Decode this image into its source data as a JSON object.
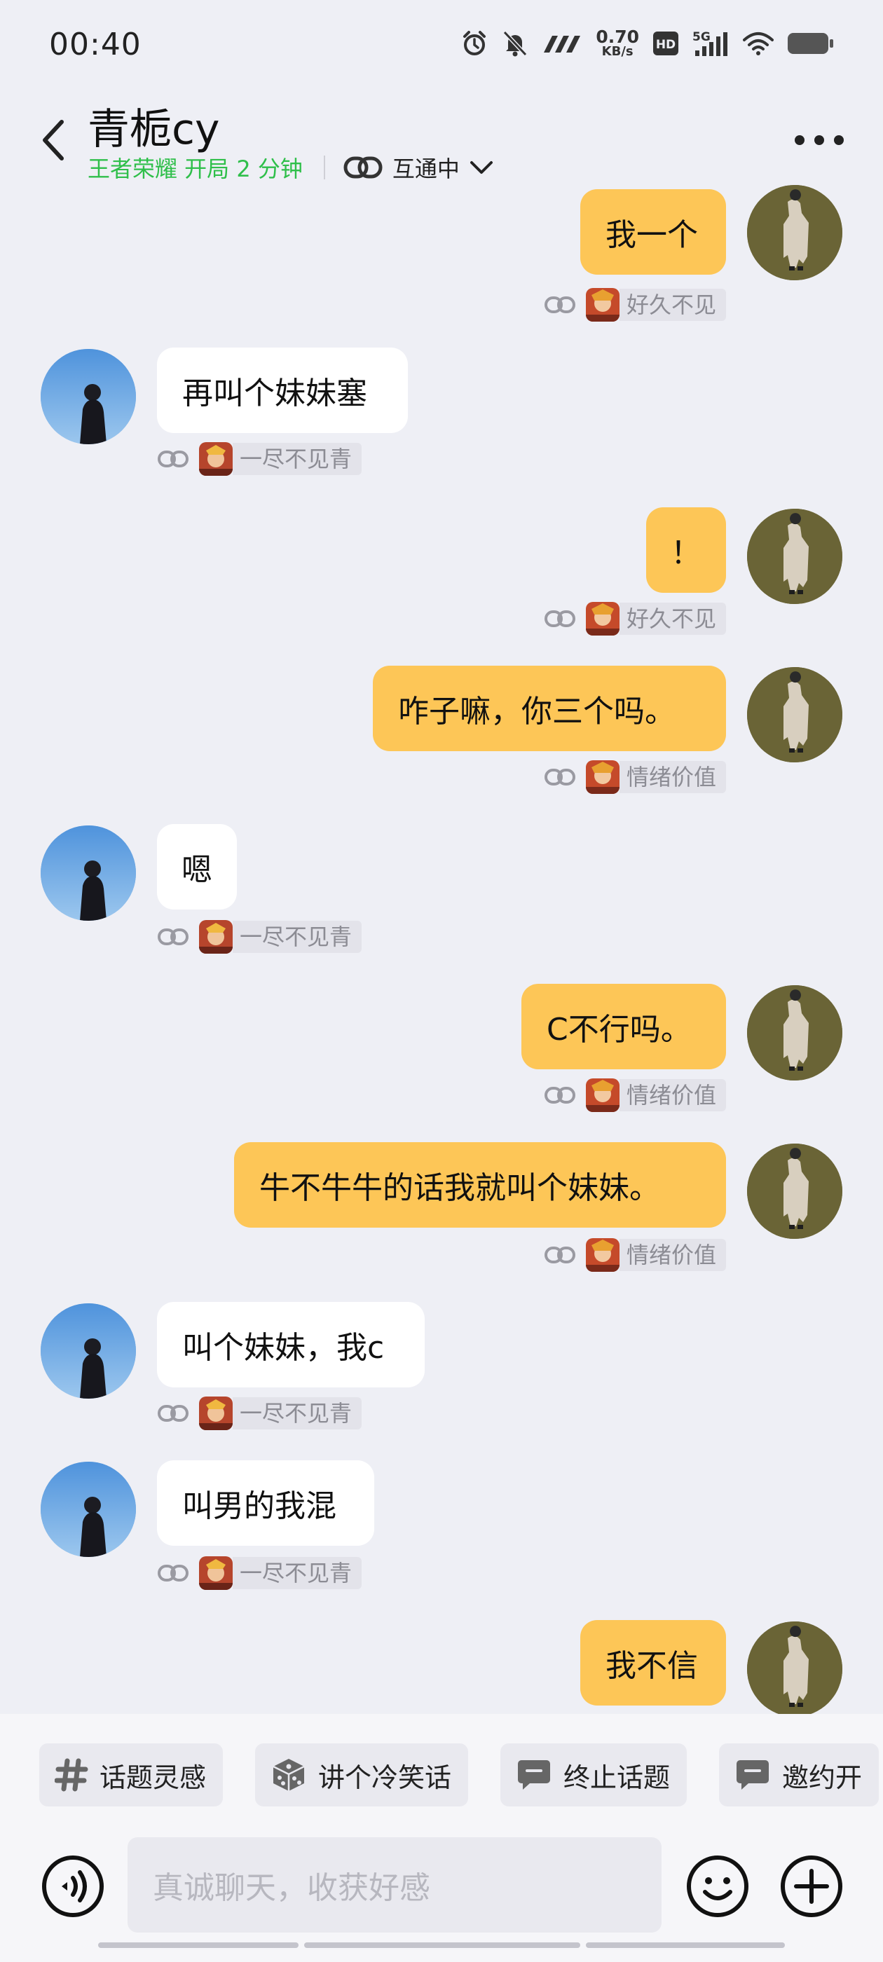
{
  "status_bar": {
    "time": "00:40",
    "net_speed_value": "0.70",
    "net_speed_unit": "KB/s",
    "hd_label": "HD",
    "signal_label": "5G"
  },
  "header": {
    "contact_name": "青栀cy",
    "game_status": "王者荣耀 开局 2 分钟",
    "link_status": "互通中"
  },
  "colors": {
    "self_bubble": "#fdc657",
    "peer_bubble": "#ffffff",
    "game_status_green": "#2fbf4a",
    "background": "#eeeff5"
  },
  "messages": [
    {
      "side": "self",
      "text": "我一个",
      "nickname": "好久不见"
    },
    {
      "side": "peer",
      "text": "再叫个妹妹塞",
      "nickname": "一尽不见青"
    },
    {
      "side": "self",
      "text": "！",
      "nickname": "好久不见"
    },
    {
      "side": "self",
      "text": "咋子嘛，你三个吗。",
      "nickname": "情绪价值"
    },
    {
      "side": "peer",
      "text": "嗯",
      "nickname": "一尽不见青"
    },
    {
      "side": "self",
      "text": "C不行吗。",
      "nickname": "情绪价值"
    },
    {
      "side": "self",
      "text": "牛不牛牛的话我就叫个妹妹。",
      "nickname": "情绪价值"
    },
    {
      "side": "peer",
      "text": "叫个妹妹，我c",
      "nickname": "一尽不见青"
    },
    {
      "side": "peer",
      "text": "叫男的我混",
      "nickname": "一尽不见青"
    },
    {
      "side": "self",
      "text": "我不信",
      "nickname": ""
    }
  ],
  "suggestions": [
    {
      "label": "话题灵感",
      "icon": "hashtag-icon"
    },
    {
      "label": "讲个冷笑话",
      "icon": "dice-icon"
    },
    {
      "label": "终止话题",
      "icon": "chat-bubble-icon"
    },
    {
      "label": "邀约开",
      "icon": "chat-bubble-icon"
    }
  ],
  "input": {
    "placeholder": "真诚聊天，收获好感"
  }
}
